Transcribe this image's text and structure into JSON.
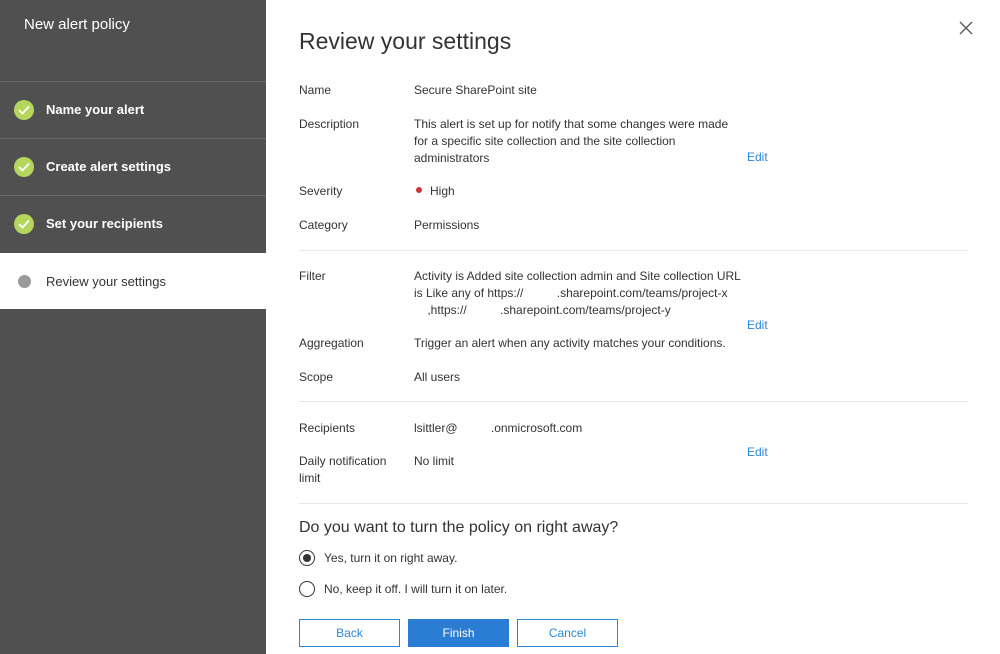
{
  "sidebar": {
    "title": "New alert policy",
    "steps": [
      {
        "label": "Name your alert",
        "status": "complete"
      },
      {
        "label": "Create alert settings",
        "status": "complete"
      },
      {
        "label": "Set your recipients",
        "status": "complete"
      },
      {
        "label": "Review your settings",
        "status": "current"
      }
    ],
    "complete_color": "#b5d65c"
  },
  "main": {
    "title": "Review your settings",
    "name": {
      "label": "Name",
      "value": "Secure SharePoint site"
    },
    "description": {
      "label": "Description",
      "value": "This alert is set up for notify that some changes were made for a specific site collection and the site collection administrators"
    },
    "severity": {
      "label": "Severity",
      "value": "High",
      "color": "#d13438"
    },
    "category": {
      "label": "Category",
      "value": "Permissions"
    },
    "filter": {
      "label": "Filter",
      "line1": "Activity is Added site collection admin and Site collection URL",
      "line2": "is Like any of https://          .sharepoint.com/teams/project-x",
      "line3": "    ,https://          .sharepoint.com/teams/project-y"
    },
    "aggregation": {
      "label": "Aggregation",
      "value": "Trigger an alert when any activity matches your conditions."
    },
    "scope": {
      "label": "Scope",
      "value": "All users"
    },
    "recipients": {
      "label": "Recipients",
      "value": "lsittler@          .onmicrosoft.com"
    },
    "daily_limit": {
      "label": "Daily notification limit",
      "value": "No limit"
    },
    "edit_label": "Edit",
    "question": "Do you want to turn the policy on right away?",
    "options": [
      {
        "label": "Yes, turn it on right away.",
        "selected": true
      },
      {
        "label": "No, keep it off. I will turn it on later.",
        "selected": false
      }
    ],
    "buttons": {
      "back": "Back",
      "finish": "Finish",
      "cancel": "Cancel"
    },
    "accent_color": "#2b88d8"
  }
}
